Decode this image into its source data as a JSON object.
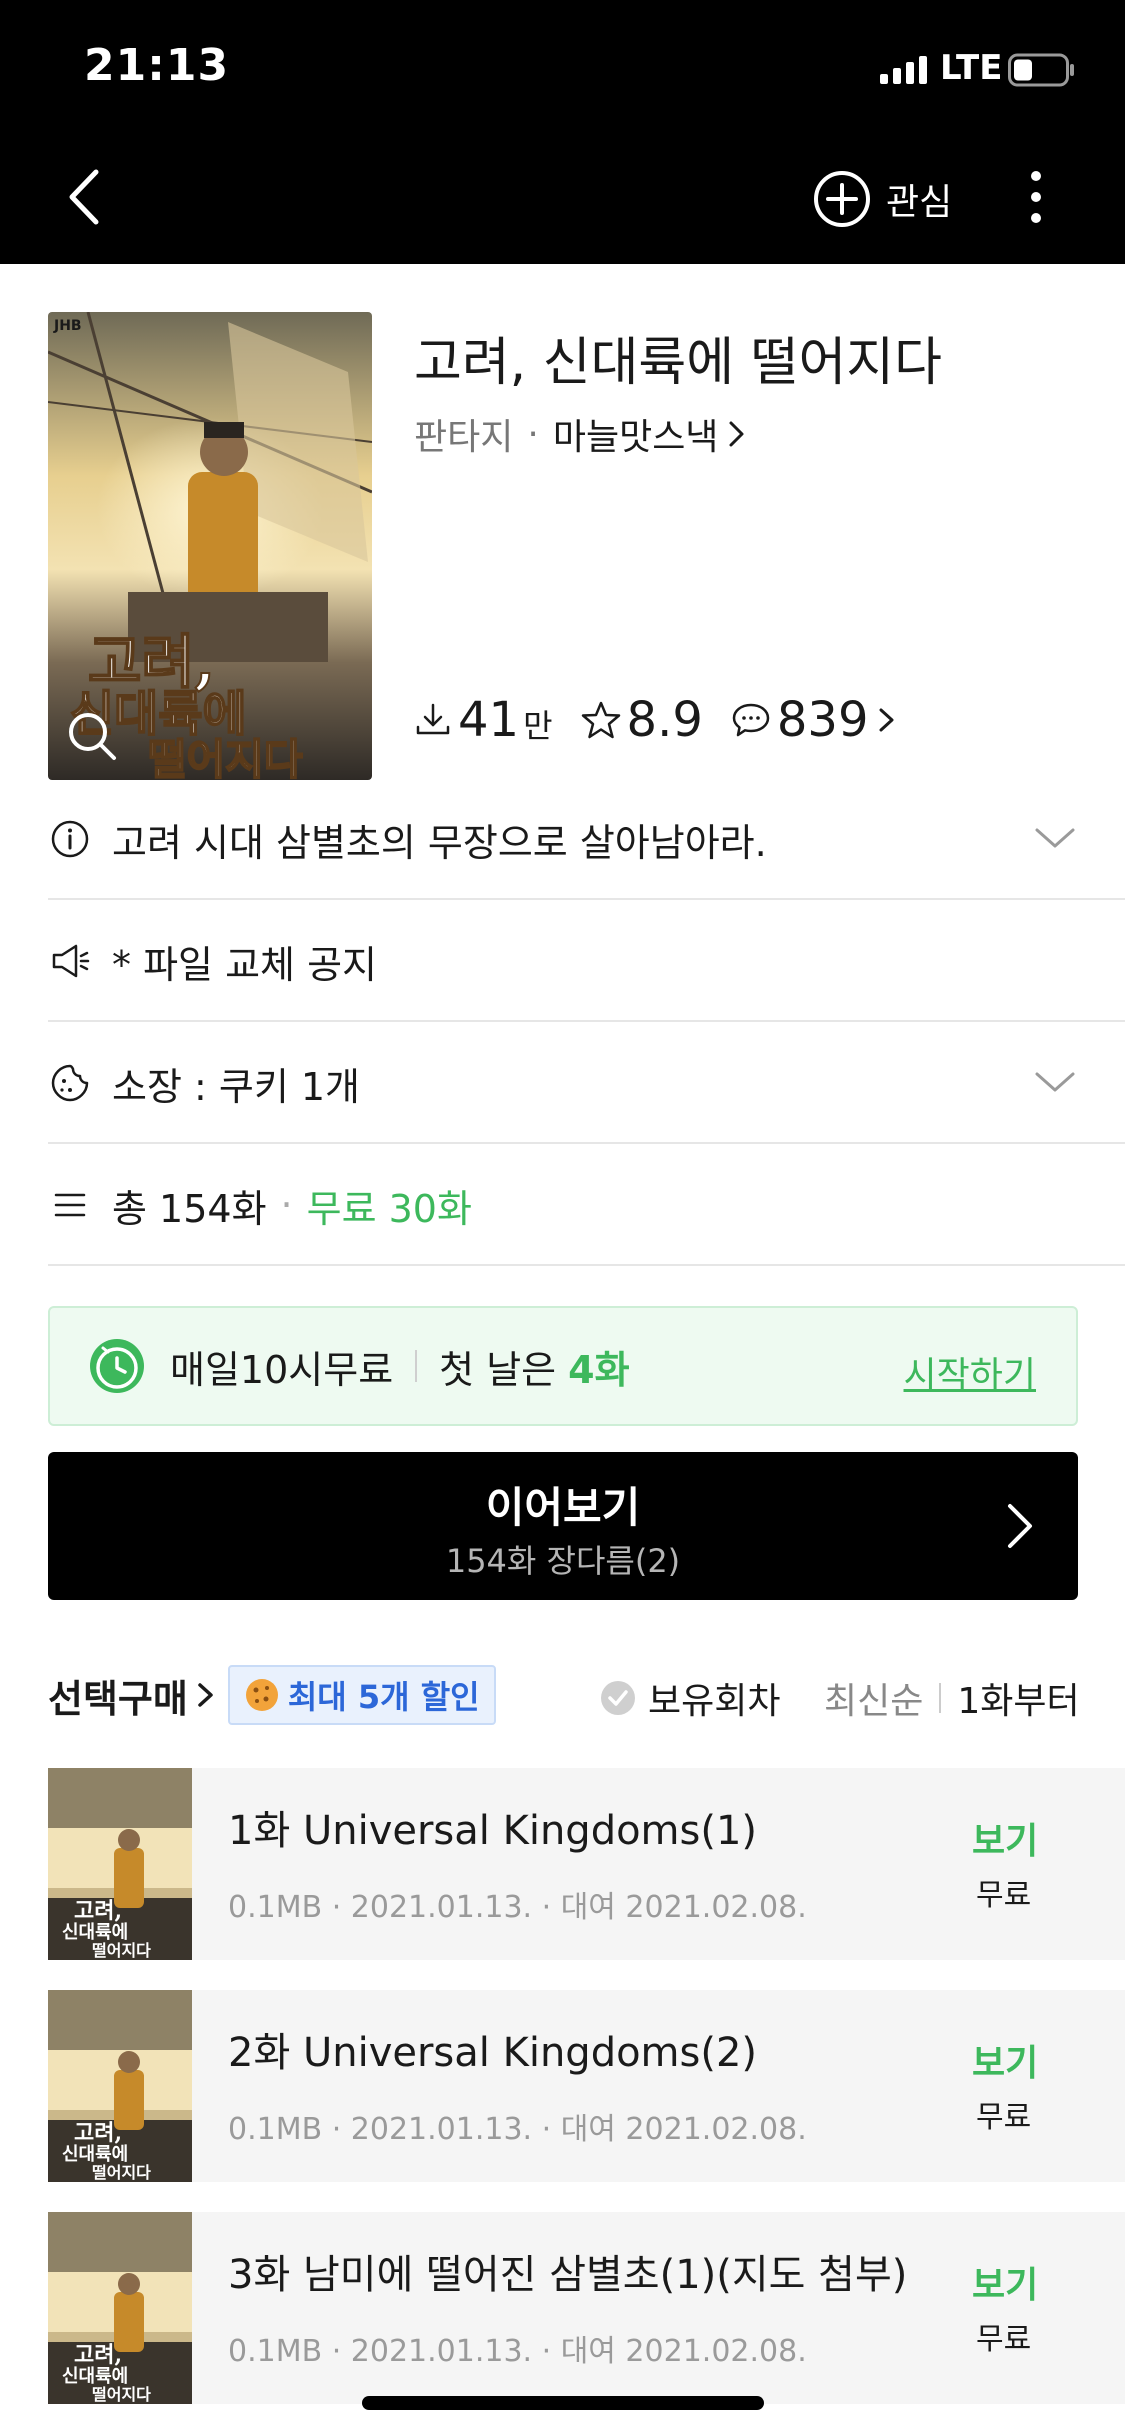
{
  "status_bar": {
    "time": "21:13",
    "network": "LTE"
  },
  "nav": {
    "favorite_label": "관심"
  },
  "book": {
    "title": "고려, 신대륙에 떨어지다",
    "genre": "판타지",
    "author": "마늘맛스낵",
    "cover_text_line1": "고려,",
    "cover_text_line2": "신대륙에",
    "cover_text_line3": "떨어지다",
    "cover_publisher": "JHB",
    "downloads": "41",
    "downloads_unit": "만",
    "rating": "8.9",
    "comments": "839"
  },
  "info_rows": {
    "summary": "고려 시대 삼별초의 무장으로 살아남아라.",
    "notice": "* 파일 교체 공지",
    "owned": "소장 : 쿠키 1개",
    "total": "총 154화",
    "free_count": "무료 30화"
  },
  "promo": {
    "label": "매일10시무료",
    "first_day_prefix": "첫 날은",
    "first_day_value": "4화",
    "start_label": "시작하기"
  },
  "continue": {
    "title": "이어보기",
    "subtitle": "154화 장다름(2)"
  },
  "list_header": {
    "select_purchase": "선택구매",
    "discount": "최대 5개 할인",
    "owned_filter": "보유회차",
    "sort_latest": "최신순",
    "sort_first": "1화부터"
  },
  "episodes": [
    {
      "title": "1화 Universal Kingdoms(1)",
      "info": "0.1MB · 2021.01.13. · 대여 2021.02.08.",
      "action": "보기",
      "price": "무료"
    },
    {
      "title": "2화 Universal Kingdoms(2)",
      "info": "0.1MB · 2021.01.13. · 대여 2021.02.08.",
      "action": "보기",
      "price": "무료"
    },
    {
      "title": "3화 남미에 떨어진 삼별초(1)(지도 첨부)",
      "info": "0.1MB · 2021.01.13. · 대여 2021.02.08.",
      "action": "보기",
      "price": "무료"
    }
  ],
  "colors": {
    "accent_green": "#3db85c",
    "discount_blue": "#2c67d8",
    "header_black": "#000000"
  }
}
